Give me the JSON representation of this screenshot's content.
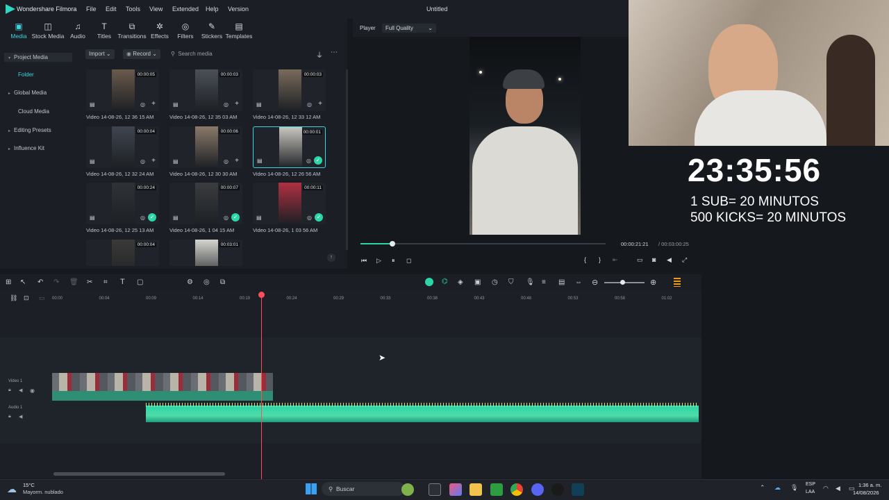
{
  "titlebar": {
    "app_name": "Wondershare Filmora",
    "menus": [
      "File",
      "Edit",
      "Tools",
      "View",
      "Extended",
      "Help",
      "Version"
    ],
    "document_title": "Untitled"
  },
  "media_toolbar": {
    "items": [
      "Media",
      "Stock Media",
      "Audio",
      "Titles",
      "Transitions",
      "Effects",
      "Filters",
      "Stickers",
      "Templates"
    ],
    "active": "Media"
  },
  "left_nav": {
    "items": [
      "Project Media",
      "Folder",
      "Global Media",
      "Cloud Media",
      "Editing Presets",
      "Influence Kit"
    ]
  },
  "browser": {
    "import_label": "Import",
    "record_label": "Record",
    "search_placeholder": "Search media",
    "clips": [
      {
        "label": "Video 14-08-26, 12 36 15 AM",
        "duration": "00:00:05",
        "checked": false,
        "selected": false
      },
      {
        "label": "Video 14-08-26, 12 35 03 AM",
        "duration": "00:00:03",
        "checked": false,
        "selected": false
      },
      {
        "label": "Video 14-08-26, 12 33 12 AM",
        "duration": "00:00:03",
        "checked": false,
        "selected": false
      },
      {
        "label": "Video 14-08-26, 12 32 24 AM",
        "duration": "00:00:04",
        "checked": false,
        "selected": false
      },
      {
        "label": "Video 14-08-26, 12 30 30 AM",
        "duration": "00:00:06",
        "checked": false,
        "selected": false
      },
      {
        "label": "Video 14-08-26, 12 26 56 AM",
        "duration": "00:00:01",
        "checked": true,
        "selected": true
      },
      {
        "label": "Video 14-08-26, 12 25 13 AM",
        "duration": "00:00:24",
        "checked": true,
        "selected": false
      },
      {
        "label": "Video 14-08-26, 1 04 15 AM",
        "duration": "00:00:07",
        "checked": true,
        "selected": false
      },
      {
        "label": "Video 14-08-26, 1 03 56 AM",
        "duration": "00:00:11",
        "checked": true,
        "selected": false
      },
      {
        "label": "",
        "duration": "00:00:04",
        "checked": false,
        "selected": false
      },
      {
        "label": "",
        "duration": "00:03:01",
        "checked": false,
        "selected": false
      }
    ]
  },
  "player": {
    "tab_label": "Player",
    "quality": "Full Quality",
    "current_time": "00:00:21:21",
    "total_time": "/ 00:03:00:25",
    "progress": 0.13
  },
  "timeline": {
    "ruler": [
      "00:00",
      "00:04",
      "00:09",
      "00:14",
      "00:19",
      "00:24",
      "00:29",
      "00:33",
      "00:38",
      "00:43",
      "00:48",
      "00:53",
      "00:58",
      "01:02"
    ],
    "video_track_label": "Video 1",
    "audio_track_label": "Audio 1"
  },
  "overlay": {
    "timer": "23:35:56",
    "rule1": "1 SUB= 20 MINUTOS",
    "rule2": "500 KICKS= 20 MINUTOS"
  },
  "taskbar": {
    "weather_temp": "15°C",
    "weather_desc": "Mayorm. nublado",
    "search_label": "Buscar",
    "lang": "ESP",
    "lang2": "LAA",
    "time": "1:36 a. m.",
    "date": "14/08/2026"
  }
}
